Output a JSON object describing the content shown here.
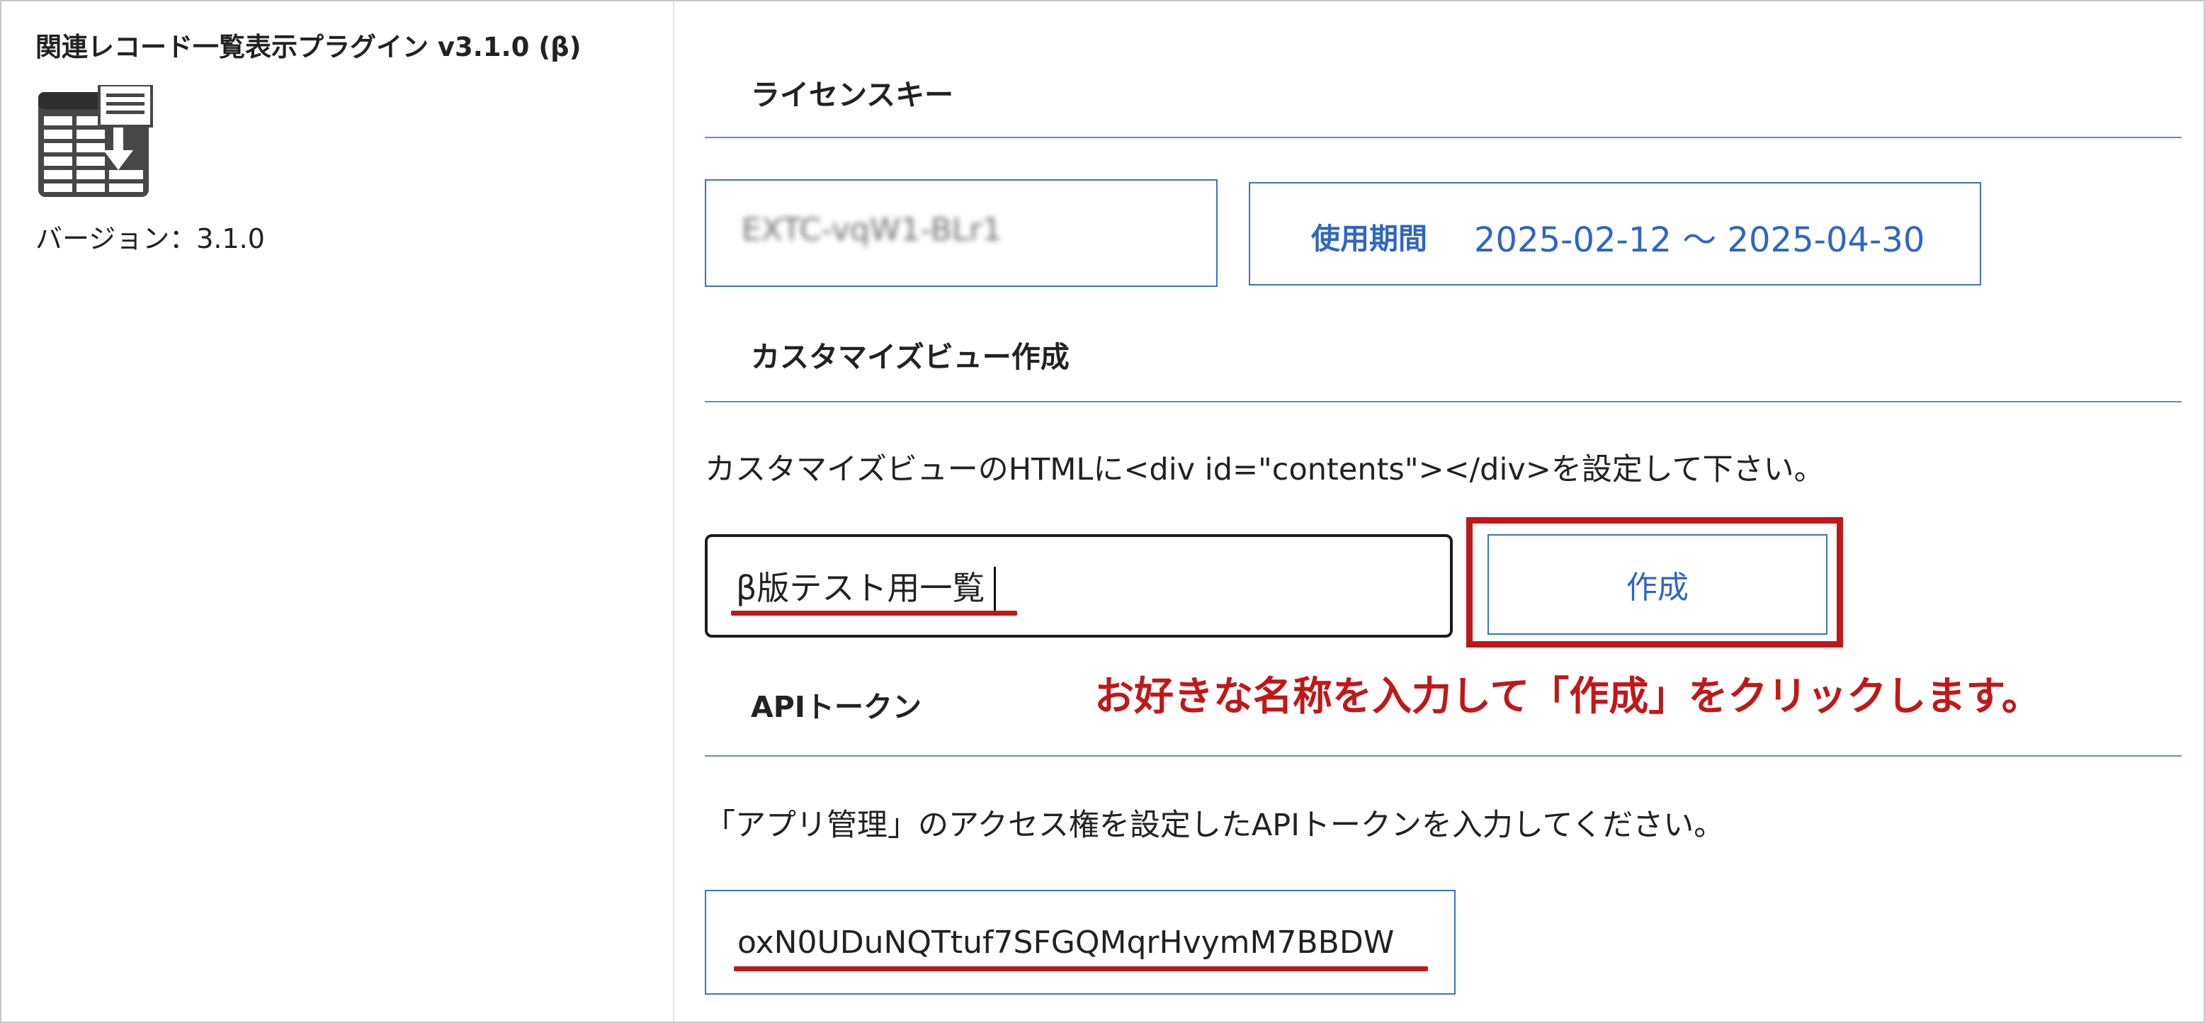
{
  "plugin": {
    "title": "関連レコード一覧表示プラグイン v3.1.0 (β)",
    "icon": "table-download-icon",
    "version_label": "バージョン：3.1.0"
  },
  "license": {
    "heading": "ライセンスキー",
    "key_obscured": "EXTC-vqW1-BLr1",
    "period_label": "使用期間",
    "period_value": "2025-02-12 ～ 2025-04-30"
  },
  "custom_view": {
    "heading": "カスタマイズビュー作成",
    "description": "カスタマイズビューのHTMLに<div id=\"contents\"></div>を設定して下さい。",
    "name_value": "β版テスト用一覧",
    "create_label": "作成",
    "annotation": "お好きな名称を入力して「作成」をクリックします。"
  },
  "api_token": {
    "heading": "APIトークン",
    "description": "「アプリ管理」のアクセス権を設定したAPIトークンを入力してください。",
    "token_value": "oxN0UDuNQTtuf7SFGQMqrHvymM7BBDW"
  },
  "colors": {
    "accent_blue": "#2f66c4",
    "border_blue": "#3d72c4",
    "annotation_red": "#c01818"
  }
}
